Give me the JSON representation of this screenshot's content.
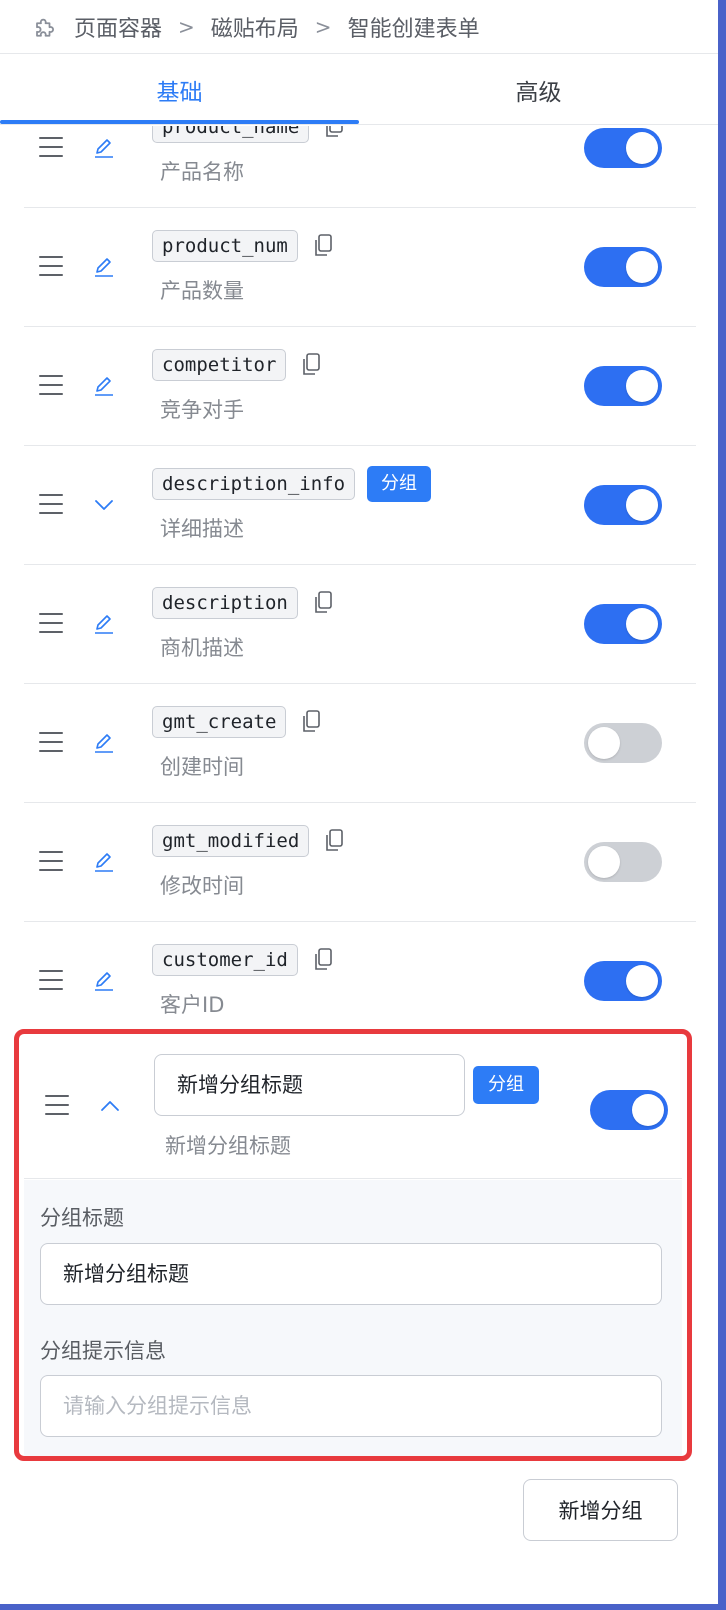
{
  "breadcrumb": {
    "items": [
      "页面容器",
      "磁贴布局",
      "智能创建表单"
    ],
    "separator": ">"
  },
  "tabs": [
    {
      "label": "基础",
      "active": true
    },
    {
      "label": "高级",
      "active": false
    }
  ],
  "fields": [
    {
      "code": "product_name",
      "label": "产品名称",
      "enabled": true,
      "is_group": false
    },
    {
      "code": "product_num",
      "label": "产品数量",
      "enabled": true,
      "is_group": false
    },
    {
      "code": "competitor",
      "label": "竞争对手",
      "enabled": true,
      "is_group": false
    },
    {
      "code": "description_info",
      "label": "详细描述",
      "enabled": true,
      "is_group": true,
      "badge": "分组"
    },
    {
      "code": "description",
      "label": "商机描述",
      "enabled": true,
      "is_group": false
    },
    {
      "code": "gmt_create",
      "label": "创建时间",
      "enabled": false,
      "is_group": false
    },
    {
      "code": "gmt_modified",
      "label": "修改时间",
      "enabled": false,
      "is_group": false
    },
    {
      "code": "customer_id",
      "label": "客户ID",
      "enabled": true,
      "is_group": false
    }
  ],
  "new_group": {
    "title_value": "新增分组标题",
    "badge": "分组",
    "label": "新增分组标题",
    "enabled": true,
    "title_field_label": "分组标题",
    "title_field_value": "新增分组标题",
    "hint_field_label": "分组提示信息",
    "hint_field_placeholder": "请输入分组提示信息"
  },
  "footer": {
    "add_group_label": "新增分组"
  },
  "colors": {
    "accent": "#2d7cf6",
    "highlight_border": "#e83a3e",
    "toggle_on": "#2d6ff2",
    "toggle_off": "#cdd0d5"
  },
  "icons": [
    "puzzle-icon",
    "drag-handle-icon",
    "edit-icon",
    "chevron-down-icon",
    "chevron-up-icon",
    "copy-icon"
  ]
}
